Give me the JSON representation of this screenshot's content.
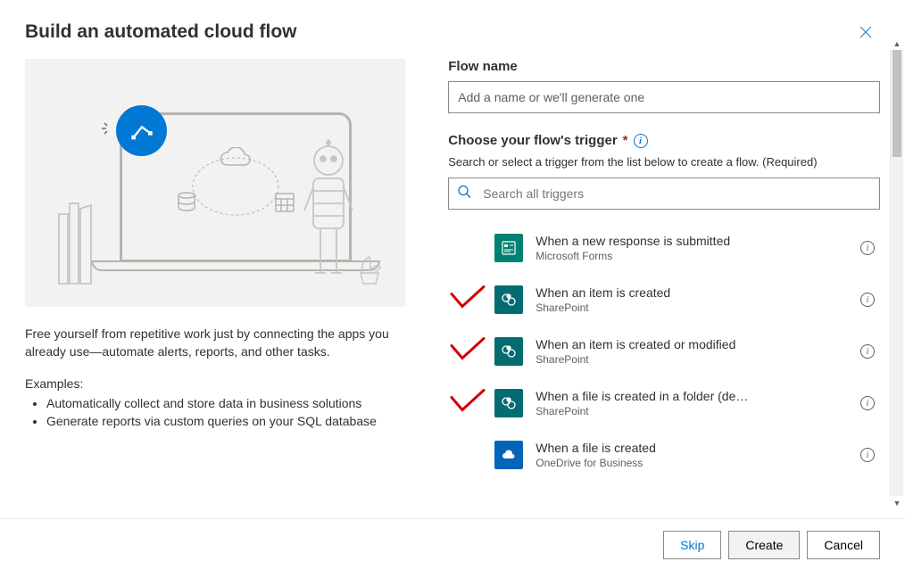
{
  "dialog": {
    "title": "Build an automated cloud flow"
  },
  "left": {
    "intro": "Free yourself from repetitive work just by connecting the apps you already use—automate alerts, reports, and other tasks.",
    "examplesTitle": "Examples:",
    "examples": [
      "Automatically collect and store data in business solutions",
      "Generate reports via custom queries on your SQL database"
    ]
  },
  "right": {
    "flowNameLabel": "Flow name",
    "flowNamePlaceholder": "Add a name or we'll generate one",
    "triggerLabel": "Choose your flow's trigger",
    "helper": "Search or select a trigger from the list below to create a flow. (Required)",
    "searchPlaceholder": "Search all triggers",
    "triggers": [
      {
        "title": "When a new response is submitted",
        "connector": "Microsoft Forms",
        "iconClass": "ic-forms",
        "icon": "forms",
        "checked": false
      },
      {
        "title": "When an item is created",
        "connector": "SharePoint",
        "iconClass": "ic-sp",
        "icon": "sp",
        "checked": true
      },
      {
        "title": "When an item is created or modified",
        "connector": "SharePoint",
        "iconClass": "ic-sp",
        "icon": "sp",
        "checked": true
      },
      {
        "title": "When a file is created in a folder (de…",
        "connector": "SharePoint",
        "iconClass": "ic-sp",
        "icon": "sp",
        "checked": true
      },
      {
        "title": "When a file is created",
        "connector": "OneDrive for Business",
        "iconClass": "ic-od",
        "icon": "od",
        "checked": false
      }
    ]
  },
  "footer": {
    "skip": "Skip",
    "create": "Create",
    "cancel": "Cancel"
  }
}
